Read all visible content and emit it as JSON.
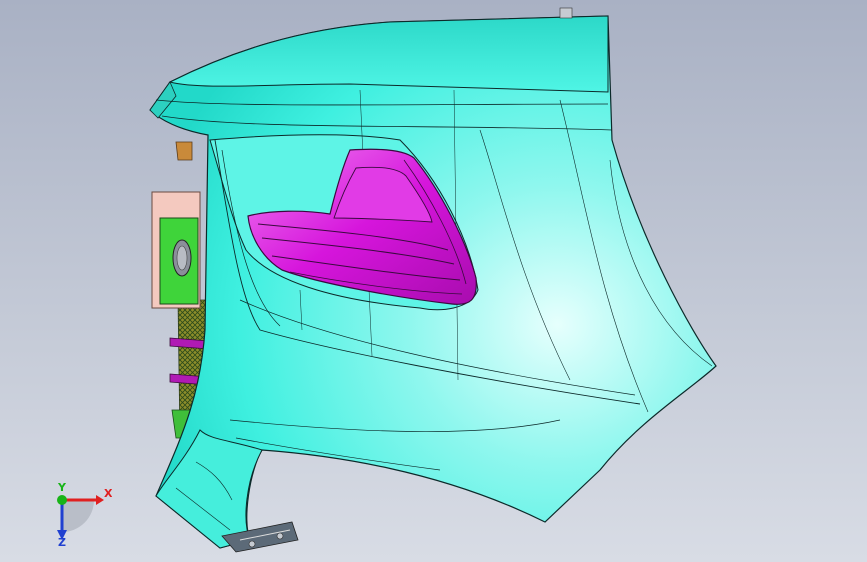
{
  "viewport": {
    "background_top": "#a9b1c4",
    "background_bottom": "#d8dce5"
  },
  "model": {
    "body_color": "#33f2e0",
    "lamp_color": "#e11ee6",
    "bracket_color": "#3fd43a",
    "flange_color": "#f4c9bf",
    "edge_color": "#0c2a2a"
  },
  "triad": {
    "x_label": "X",
    "y_label": "Y",
    "z_label": "Z",
    "x_color": "#e02020",
    "y_color": "#18b418",
    "z_color": "#2040d0"
  }
}
